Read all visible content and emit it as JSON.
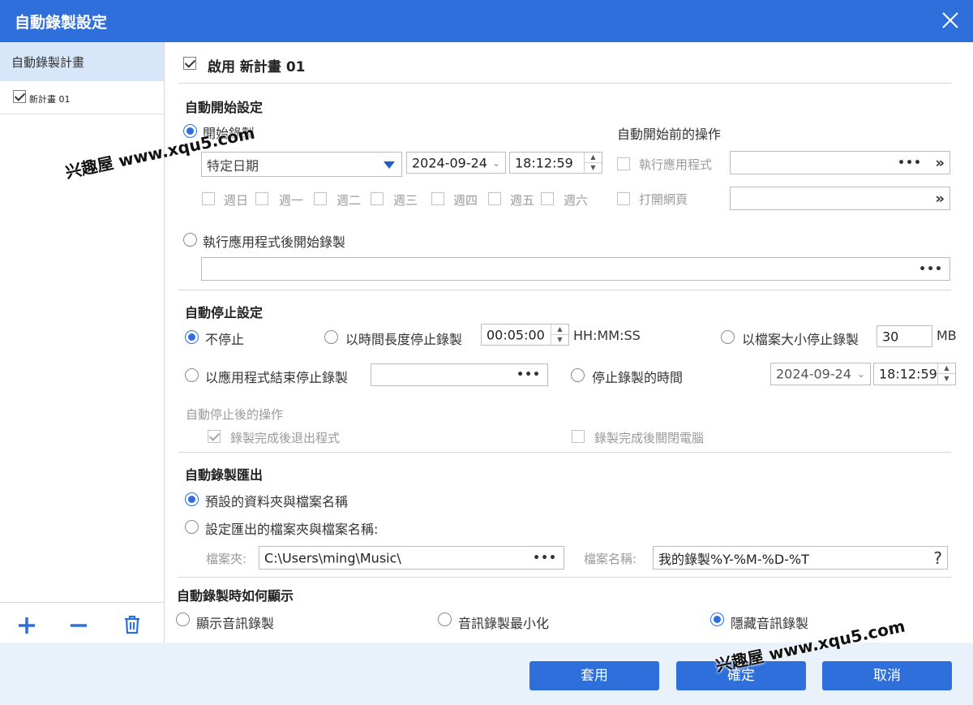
{
  "window": {
    "title": "自動錄製設定"
  },
  "sidebar": {
    "header": "自動錄製計畫",
    "items": [
      {
        "label": "新計畫 01",
        "checked": true
      }
    ]
  },
  "enable": {
    "label": "啟用 新計畫 01",
    "checked": true
  },
  "auto_start": {
    "title": "自動開始設定",
    "start_record_label": "開始錄製",
    "date_mode": "特定日期",
    "date": "2024-09-24",
    "time": "18:12:59",
    "weekdays": [
      "週日",
      "週一",
      "週二",
      "週三",
      "週四",
      "週五",
      "週六"
    ],
    "app_start_label": "執行應用程式後開始錄製",
    "pre_actions": {
      "title": "自動開始前的操作",
      "run_app_label": "執行應用程式",
      "open_web_label": "打開網頁"
    }
  },
  "auto_stop": {
    "title": "自動停止設定",
    "no_stop": "不停止",
    "by_duration": "以時間長度停止錄製",
    "duration": "00:05:00",
    "duration_unit": "HH:MM:SS",
    "by_size": "以檔案大小停止錄製",
    "size": "30",
    "size_unit": "MB",
    "by_app_end": "以應用程式結束停止錄製",
    "stop_time_label": "停止錄製的時間",
    "stop_date": "2024-09-24",
    "stop_time": "18:12:59",
    "after_title": "自動停止後的操作",
    "exit_after": "錄製完成後退出程式",
    "shutdown_after": "錄製完成後關閉電腦"
  },
  "export": {
    "title": "自動錄製匯出",
    "default_label": "預設的資料夾與檔案名稱",
    "custom_label": "設定匯出的檔案夾與檔案名稱:",
    "folder_label": "檔案夾:",
    "folder": "C:\\Users\\ming\\Music\\",
    "filename_label": "檔案名稱:",
    "filename": "我的錄製%Y-%M-%D-%T",
    "help": "?"
  },
  "display": {
    "title": "自動錄製時如何顯示",
    "show": "顯示音訊錄製",
    "minimize": "音訊錄製最小化",
    "hide": "隱藏音訊錄製"
  },
  "buttons": {
    "apply": "套用",
    "ok": "確定",
    "cancel": "取消"
  },
  "ui": {
    "ellipsis": "•••",
    "chevron": "»",
    "dropdown": "⌄"
  },
  "watermark": "兴趣屋 www.xqu5.com",
  "colors": {
    "accent": "#2f6fdb",
    "sidebar_selected": "#d7e6f8",
    "footer": "#e9f1fb"
  }
}
